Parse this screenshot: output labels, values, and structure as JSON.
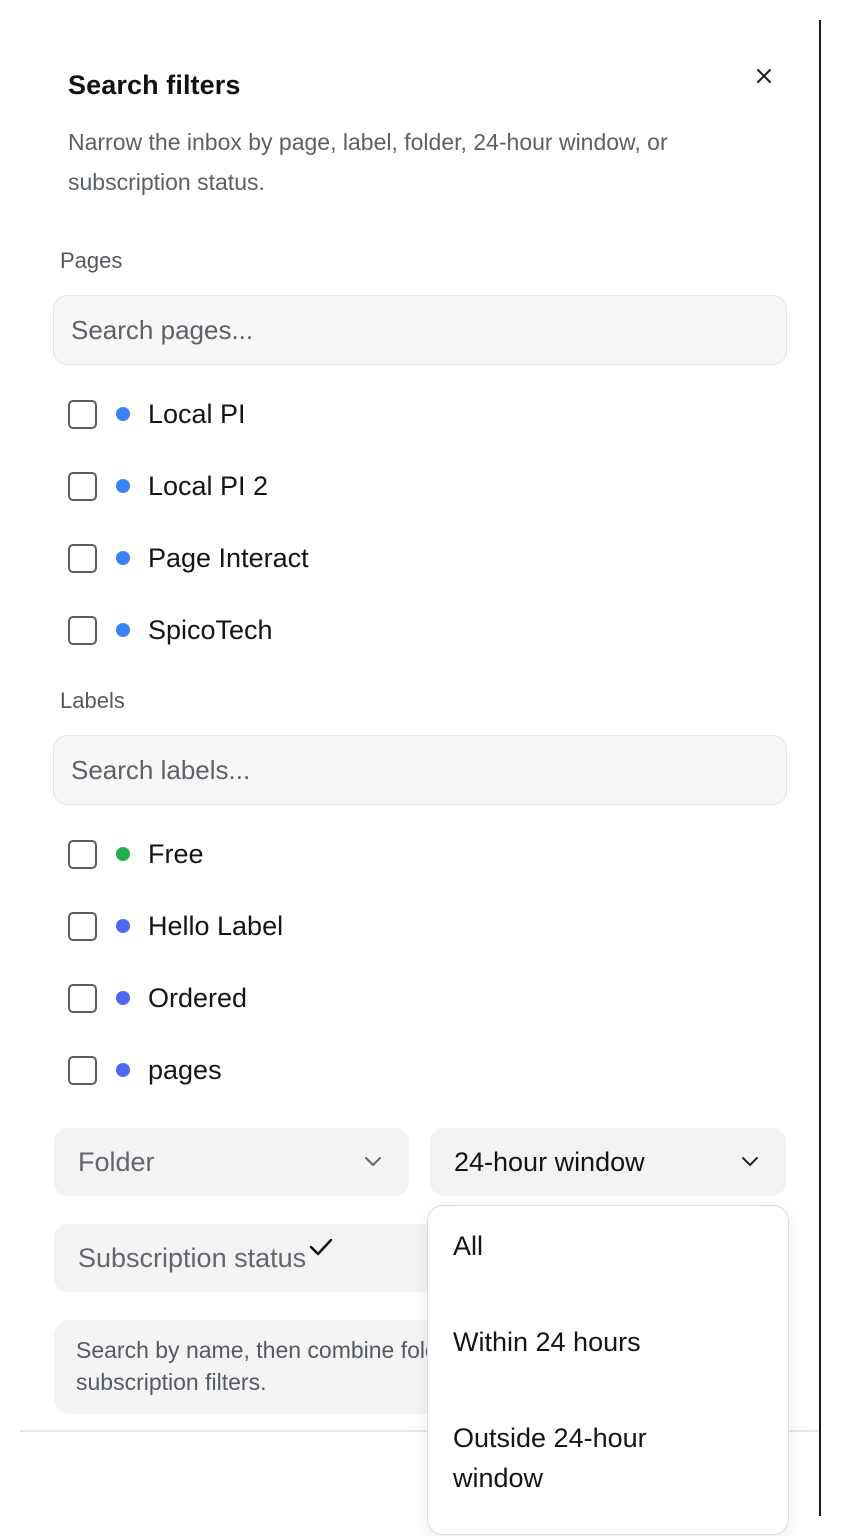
{
  "panel": {
    "title": "Search filters",
    "description": "Narrow the inbox by page, label, folder, 24-hour window, or subscription status."
  },
  "pages_section": {
    "label": "Pages",
    "search_placeholder": "Search pages...",
    "items": [
      {
        "label": "Local PI",
        "color": "#3b82f6"
      },
      {
        "label": "Local PI 2",
        "color": "#3b82f6"
      },
      {
        "label": "Page Interact",
        "color": "#3b82f6"
      },
      {
        "label": "SpicoTech",
        "color": "#3b82f6"
      }
    ]
  },
  "labels_section": {
    "label": "Labels",
    "search_placeholder": "Search labels...",
    "items": [
      {
        "label": "Free",
        "color": "#22b04b"
      },
      {
        "label": "Hello Label",
        "color": "#4f67f0"
      },
      {
        "label": "Ordered",
        "color": "#4f67f0"
      },
      {
        "label": "pages",
        "color": "#4f67f0"
      }
    ]
  },
  "filters": {
    "folder_placeholder": "Folder",
    "window_selected": "24-hour window",
    "subscription_placeholder": "Subscription status"
  },
  "hint": {
    "text": "Search by name, then combine folder, 24-hour window, and subscription filters."
  },
  "window_dropdown": {
    "options": [
      "All",
      "Within 24 hours",
      "Outside 24-hour window"
    ],
    "selected_index": 0
  },
  "icons": {
    "close": "close-icon",
    "chevron": "chevron-down-icon",
    "check": "check-icon"
  }
}
